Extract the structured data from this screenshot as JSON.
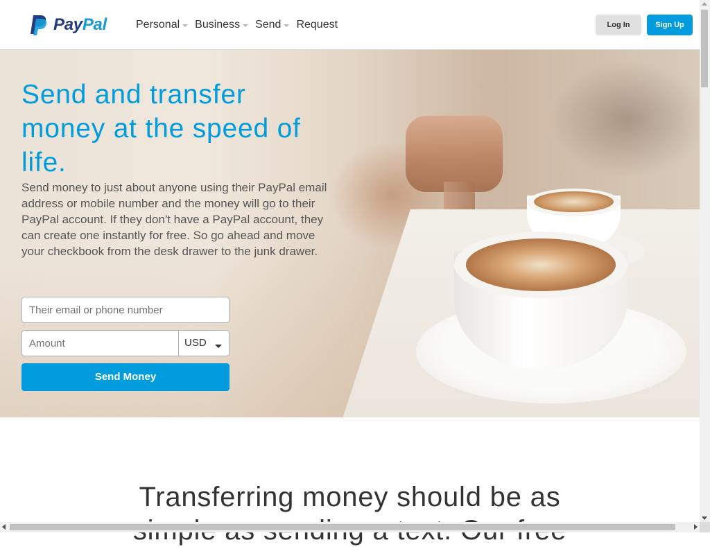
{
  "brand": {
    "name_part1": "Pay",
    "name_part2": "Pal",
    "icon": "paypal-logo-icon",
    "color_dark": "#253b80",
    "color_light": "#179bd7"
  },
  "nav": {
    "items": [
      {
        "label": "Personal",
        "has_dropdown": true
      },
      {
        "label": "Business",
        "has_dropdown": true
      },
      {
        "label": "Send",
        "has_dropdown": true
      },
      {
        "label": "Request",
        "has_dropdown": false
      }
    ]
  },
  "header": {
    "login_label": "Log In",
    "signup_label": "Sign Up"
  },
  "hero": {
    "title": "Send and transfer money at the speed of life.",
    "description": "Send money to just about anyone using their PayPal email address or mobile number and the money will go to their PayPal account. If they don't have a PayPal account, they can create one instantly for free. So go ahead and move your checkbook from the desk drawer to the junk drawer.",
    "email_placeholder": "Their email or phone number",
    "amount_placeholder": "Amount",
    "currency": "USD",
    "send_label": "Send Money",
    "accent_color": "#009cde"
  },
  "section": {
    "title_line1": "Transferring money should be as",
    "title_line2": "simple as sending a text. Our free"
  }
}
